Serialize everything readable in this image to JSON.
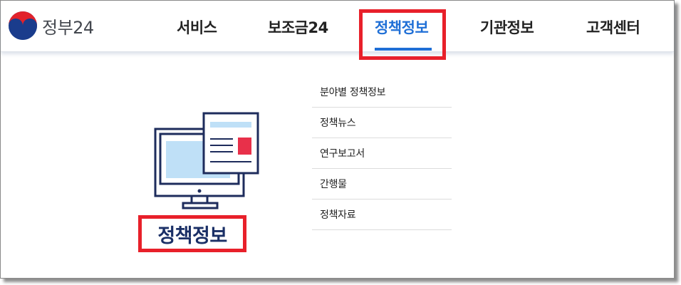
{
  "brand": {
    "name": "정부24",
    "logo_icon": "taegeuk-logo-icon"
  },
  "nav": {
    "items": [
      {
        "label": "서비스",
        "active": false
      },
      {
        "label": "보조금24",
        "active": false
      },
      {
        "label": "정책정보",
        "active": true
      },
      {
        "label": "기관정보",
        "active": false
      },
      {
        "label": "고객센터",
        "active": false
      }
    ]
  },
  "panel": {
    "title": "정책정보",
    "illustration_icon": "monitor-document-icon",
    "submenu": [
      {
        "label": "분야별 정책정보"
      },
      {
        "label": "정책뉴스"
      },
      {
        "label": "연구보고서"
      },
      {
        "label": "간행물"
      },
      {
        "label": "정책자료"
      }
    ]
  },
  "colors": {
    "accent": "#1f6fd6",
    "highlight_box": "#e8202a",
    "title_navy": "#1a2f66",
    "illustration_navy": "#1e2c5c",
    "illustration_light_blue": "#bfe0f7",
    "illustration_red": "#e8304a"
  }
}
